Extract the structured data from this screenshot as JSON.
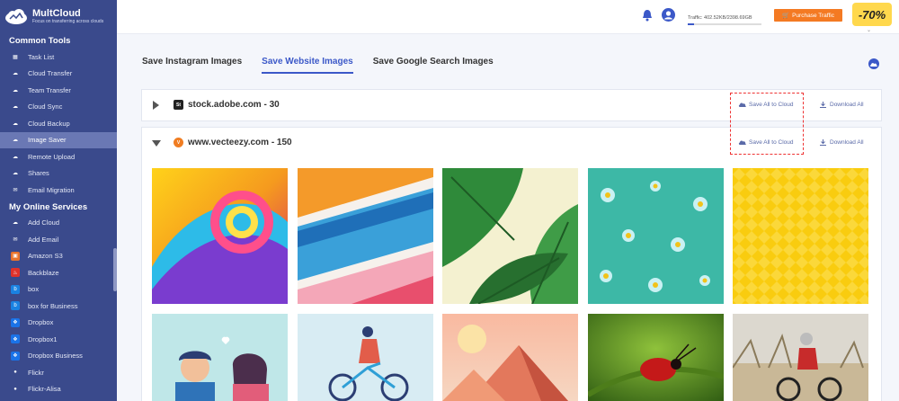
{
  "app": {
    "name": "MultCloud",
    "tagline": "Focus on transferring across clouds"
  },
  "sidebar": {
    "common_title": "Common Tools",
    "common_items": [
      {
        "label": "Task List",
        "icon": "grid-icon"
      },
      {
        "label": "Cloud Transfer",
        "icon": "cloud-transfer-icon"
      },
      {
        "label": "Team Transfer",
        "icon": "team-transfer-icon"
      },
      {
        "label": "Cloud Sync",
        "icon": "cloud-sync-icon"
      },
      {
        "label": "Cloud Backup",
        "icon": "cloud-backup-icon"
      },
      {
        "label": "Image Saver",
        "icon": "image-saver-icon",
        "active": true
      },
      {
        "label": "Remote Upload",
        "icon": "remote-upload-icon"
      },
      {
        "label": "Shares",
        "icon": "shares-icon"
      },
      {
        "label": "Email Migration",
        "icon": "email-migration-icon"
      }
    ],
    "services_title": "My Online Services",
    "service_items": [
      {
        "label": "Add Cloud",
        "icon": "add-cloud-icon",
        "color": "#ffffff"
      },
      {
        "label": "Add Email",
        "icon": "add-email-icon",
        "color": "#ffffff"
      },
      {
        "label": "Amazon S3",
        "icon": "amazon-s3-icon",
        "color": "#e8732c"
      },
      {
        "label": "Backblaze",
        "icon": "backblaze-icon",
        "color": "#e0322b"
      },
      {
        "label": "box",
        "icon": "box-icon",
        "color": "#1a82e2"
      },
      {
        "label": "box for Business",
        "icon": "box-business-icon",
        "color": "#1a82e2"
      },
      {
        "label": "Dropbox",
        "icon": "dropbox-icon",
        "color": "#1a73e8"
      },
      {
        "label": "Dropbox1",
        "icon": "dropbox-icon",
        "color": "#1a73e8"
      },
      {
        "label": "Dropbox Business",
        "icon": "dropbox-icon",
        "color": "#1a73e8"
      },
      {
        "label": "Flickr",
        "icon": "flickr-icon",
        "color": "#ffffff"
      },
      {
        "label": "Flickr-Alisa",
        "icon": "flickr-icon",
        "color": "#ffffff"
      }
    ]
  },
  "topbar": {
    "traffic": "Traffic: 402.52KB/2398.69GB",
    "traffic_fraction": 0.08,
    "purchase_label": "Purchase Traffic",
    "promo": "-70%"
  },
  "tabs": [
    {
      "label": "Save Instagram Images",
      "active": false
    },
    {
      "label": "Save Website Images",
      "active": true
    },
    {
      "label": "Save Google Search Images",
      "active": false
    }
  ],
  "sources": [
    {
      "site": "stock.adobe.com - 30",
      "favicon": "St",
      "favicon_color": "#222222",
      "expanded": false,
      "save_label": "Save All to Cloud",
      "download_label": "Download All"
    },
    {
      "site": "www.vecteezy.com - 150",
      "favicon": "V",
      "favicon_color": "#f07d22",
      "expanded": true,
      "save_label": "Save All to Cloud",
      "download_label": "Download All"
    }
  ],
  "images": [
    {
      "name": "abstract-swirl-image"
    },
    {
      "name": "geometric-stripes-image"
    },
    {
      "name": "palm-leaves-image"
    },
    {
      "name": "flower-pattern-image"
    },
    {
      "name": "yellow-pattern-image"
    },
    {
      "name": "couple-illustration-image"
    },
    {
      "name": "bicycle-illustration-image"
    },
    {
      "name": "pyramid-sunset-image"
    },
    {
      "name": "red-beetle-image"
    },
    {
      "name": "mountain-biker-image"
    }
  ]
}
